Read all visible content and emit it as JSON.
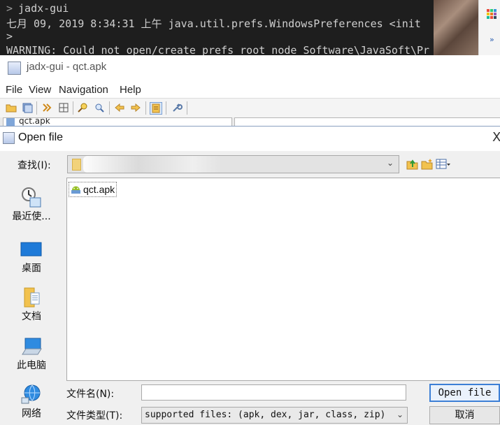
{
  "terminal": {
    "lines": [
      "jadx-gui",
      "七月 09, 2019 8:34:31 上午 java.util.prefs.WindowsPreferences <init",
      ">",
      "WARNING: Could not open/create prefs root node Software\\JavaSoft\\Pr"
    ],
    "prompt_symbol": ">"
  },
  "jadx": {
    "window_title": "jadx-gui - qct.apk",
    "menu": [
      "File",
      "View",
      "Navigation",
      "Help"
    ],
    "tree_root": "qct.apk"
  },
  "dialog": {
    "title": "Open file",
    "close_glyph": "X",
    "look_in_label": "查找(I):",
    "look_in_value": "",
    "places": [
      "最近使...",
      "桌面",
      "文档",
      "此电脑",
      "网络"
    ],
    "files": [
      {
        "name": "qct.apk",
        "icon": "android-apk-icon"
      }
    ],
    "file_name_label": "文件名(N):",
    "file_name_value": "",
    "file_type_label": "文件类型(T):",
    "file_type_value": "supported files: (apk, dex, jar, class, zip)",
    "open_button": "Open file",
    "cancel_button": "取消"
  },
  "colors": {
    "terminal_bg": "#1e1e1e",
    "accent_border": "#3c7fd6"
  }
}
